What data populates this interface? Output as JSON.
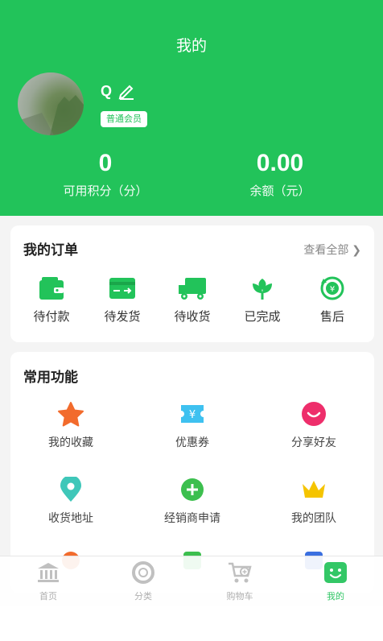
{
  "header": {
    "title": "我的",
    "username": "Q",
    "member_level": "普通会员",
    "stats": [
      {
        "value": "0",
        "label": "可用积分（分）"
      },
      {
        "value": "0.00",
        "label": "余额（元）"
      }
    ]
  },
  "orders": {
    "title": "我的订单",
    "view_all": "查看全部",
    "items": [
      {
        "label": "待付款",
        "icon": "wallet-icon"
      },
      {
        "label": "待发货",
        "icon": "card-send-icon"
      },
      {
        "label": "待收货",
        "icon": "truck-icon"
      },
      {
        "label": "已完成",
        "icon": "flower-icon"
      },
      {
        "label": "售后",
        "icon": "refund-icon"
      }
    ]
  },
  "functions": {
    "title": "常用功能",
    "items": [
      {
        "label": "我的收藏",
        "icon": "star-icon",
        "color": "#f26b2c"
      },
      {
        "label": "优惠券",
        "icon": "coupon-icon",
        "color": "#3ec1f0"
      },
      {
        "label": "分享好友",
        "icon": "smile-icon",
        "color": "#ee2e6b"
      },
      {
        "label": "收货地址",
        "icon": "location-icon",
        "color": "#3fc7b9"
      },
      {
        "label": "经销商申请",
        "icon": "plus-circle-icon",
        "color": "#3cbf4e"
      },
      {
        "label": "我的团队",
        "icon": "crown-icon",
        "color": "#f5c400"
      }
    ]
  },
  "tabbar": {
    "items": [
      {
        "label": "首页",
        "icon": "bank-icon"
      },
      {
        "label": "分类",
        "icon": "lifebuoy-icon"
      },
      {
        "label": "购物车",
        "icon": "cart-icon"
      },
      {
        "label": "我的",
        "icon": "profile-icon"
      }
    ],
    "active_index": 3
  },
  "colors": {
    "brand": "#22c35a"
  }
}
